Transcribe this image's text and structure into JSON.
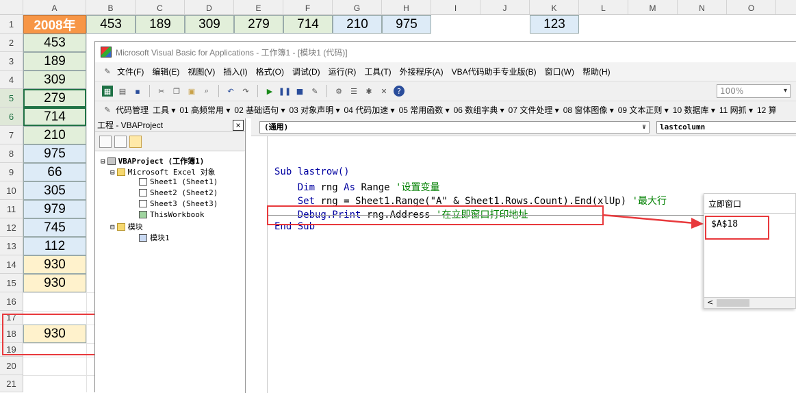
{
  "sheet": {
    "col_headers": [
      "A",
      "B",
      "C",
      "D",
      "E",
      "F",
      "G",
      "H",
      "I",
      "J",
      "K",
      "L",
      "M",
      "N",
      "O"
    ],
    "row_headers": [
      "1",
      "2",
      "3",
      "4",
      "5",
      "6",
      "7",
      "8",
      "9",
      "10",
      "11",
      "12",
      "13",
      "14",
      "15",
      "16",
      "17",
      "18",
      "19",
      "20",
      "21"
    ],
    "a1": "2008年",
    "row1": [
      "453",
      "189",
      "309",
      "279",
      "714",
      "210",
      "975"
    ],
    "k1": "123",
    "col_a": [
      "453",
      "189",
      "309",
      "279",
      "714",
      "210",
      "975",
      "66",
      "305",
      "979",
      "745",
      "112",
      "930",
      "930"
    ],
    "a18": "930"
  },
  "vbe": {
    "title": "Microsoft Visual Basic for Applications - 工作簿1 - [模块1 (代码)]",
    "menu": [
      "文件(F)",
      "编辑(E)",
      "视图(V)",
      "插入(I)",
      "格式(O)",
      "调试(D)",
      "运行(R)",
      "工具(T)",
      "外接程序(A)",
      "VBA代码助手专业版(B)",
      "窗口(W)",
      "帮助(H)"
    ],
    "zoom": "100%",
    "toolbar2": [
      "代码管理",
      "工具 ▾",
      "01 高频常用 ▾",
      "02 基础语句 ▾",
      "03 对象声明 ▾",
      "04 代码加速 ▾",
      "05 常用函数 ▾",
      "06 数组字典 ▾",
      "07 文件处理 ▾",
      "08 窗体图像 ▾",
      "09 文本正则 ▾",
      "10 数据库 ▾",
      "11 网抓 ▾",
      "12 算"
    ],
    "project": {
      "title": "工程 - VBAProject",
      "close": "×",
      "nodes": [
        "VBAProject (工作簿1)",
        "Microsoft Excel 对象",
        "Sheet1 (Sheet1)",
        "Sheet2 (Sheet2)",
        "Sheet3 (Sheet3)",
        "ThisWorkbook",
        "模块",
        "模块1"
      ]
    },
    "code": {
      "object_combo": "(通用)",
      "proc_combo": "lastcolumn",
      "line1": "Sub lastrow()",
      "line2_kw1": "Dim",
      "line2_mid": " rng ",
      "line2_kw2": "As",
      "line2_rest": " Range ",
      "line2_cm": "'设置变量",
      "line3_kw": "Set",
      "line3_rest": " rng = Sheet1.Range(\"A\" & Sheet1.Rows.Count).End(xlUp) ",
      "line3_cm": "'最大行",
      "line4_kw": "Debug.Print",
      "line4_rest": " rng.Address ",
      "line4_cm": "'在立即窗口打印地址",
      "line5": "End Sub"
    },
    "immediate": {
      "title": "立即窗口",
      "output": "$A$18",
      "scroll_left": "<"
    }
  },
  "colors": {
    "a1_fill": "#f79646",
    "green_fill": "#e2efda",
    "blue_fill": "#ddebf7",
    "yellow_fill": "#fff2cc",
    "annotation_red": "#e8393c"
  }
}
